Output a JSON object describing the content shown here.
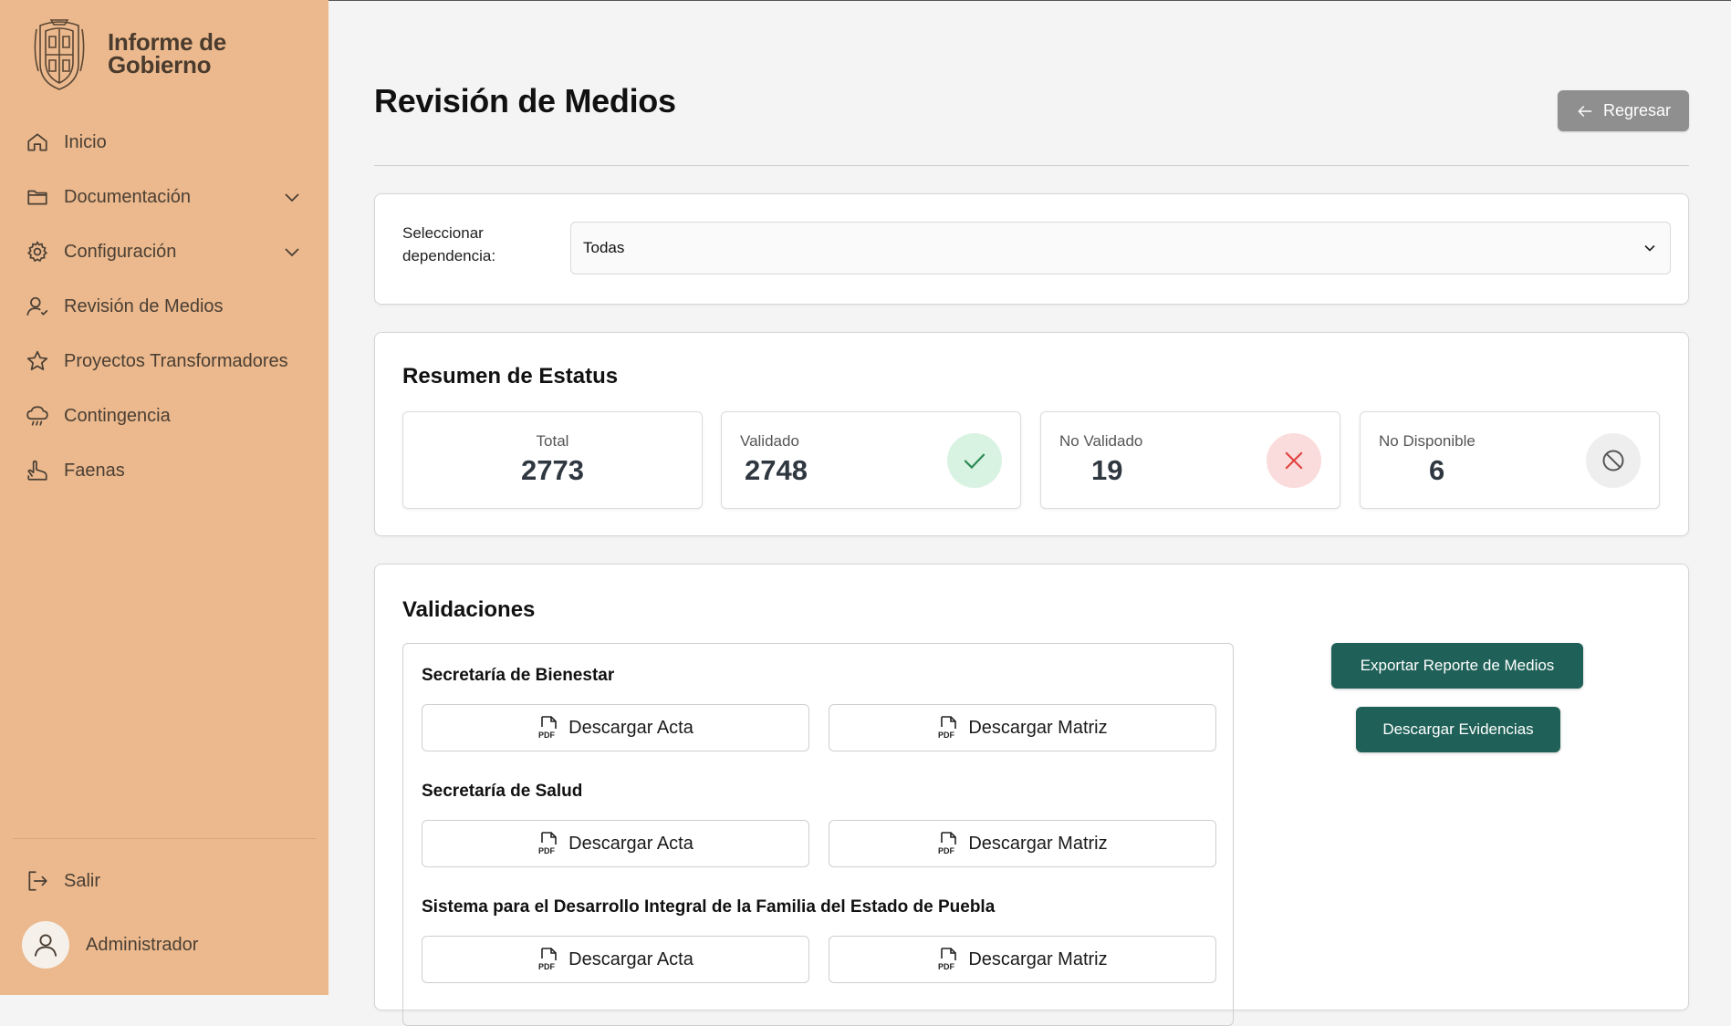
{
  "app": {
    "title_line1": "Informe de",
    "title_line2": "Gobierno"
  },
  "sidebar": {
    "items": [
      {
        "label": "Inicio",
        "icon": "home-icon"
      },
      {
        "label": "Documentación",
        "icon": "folder-icon",
        "has_submenu": true
      },
      {
        "label": "Configuración",
        "icon": "gear-icon",
        "has_submenu": true
      },
      {
        "label": "Revisión de Medios",
        "icon": "user-check-icon"
      },
      {
        "label": "Proyectos Transformadores",
        "icon": "star-icon"
      },
      {
        "label": "Contingencia",
        "icon": "storm-cloud-icon"
      },
      {
        "label": "Faenas",
        "icon": "hand-icon"
      }
    ],
    "logout_label": "Salir",
    "user_name": "Administrador"
  },
  "header": {
    "title": "Revisión de Medios",
    "back_label": "Regresar"
  },
  "filter": {
    "label_line1": "Seleccionar",
    "label_line2": "dependencia:",
    "selected": "Todas"
  },
  "status": {
    "title": "Resumen de Estatus",
    "total": {
      "label": "Total",
      "value": "2773"
    },
    "validated": {
      "label": "Validado",
      "value": "2748",
      "icon": "check-icon",
      "color": "#2e8b57"
    },
    "not_validated": {
      "label": "No Validado",
      "value": "19",
      "icon": "x-icon",
      "color": "#e0413f"
    },
    "not_available": {
      "label": "No Disponible",
      "value": "6",
      "icon": "ban-icon",
      "color": "#555555"
    }
  },
  "validations": {
    "title": "Validaciones",
    "dependencies": [
      {
        "name": "Secretaría de Bienestar",
        "acta_label": "Descargar Acta",
        "matriz_label": "Descargar Matriz"
      },
      {
        "name": "Secretaría de Salud",
        "acta_label": "Descargar Acta",
        "matriz_label": "Descargar Matriz"
      },
      {
        "name": "Sistema para el Desarrollo Integral de la Familia del Estado de Puebla",
        "acta_label": "Descargar Acta",
        "matriz_label": "Descargar Matriz"
      }
    ],
    "export_label": "Exportar Reporte de Medios",
    "evidence_label": "Descargar Evidencias"
  },
  "colors": {
    "sidebar": "#ebb98d",
    "primary_button": "#1f6158",
    "back_button": "#8f8f8f"
  }
}
